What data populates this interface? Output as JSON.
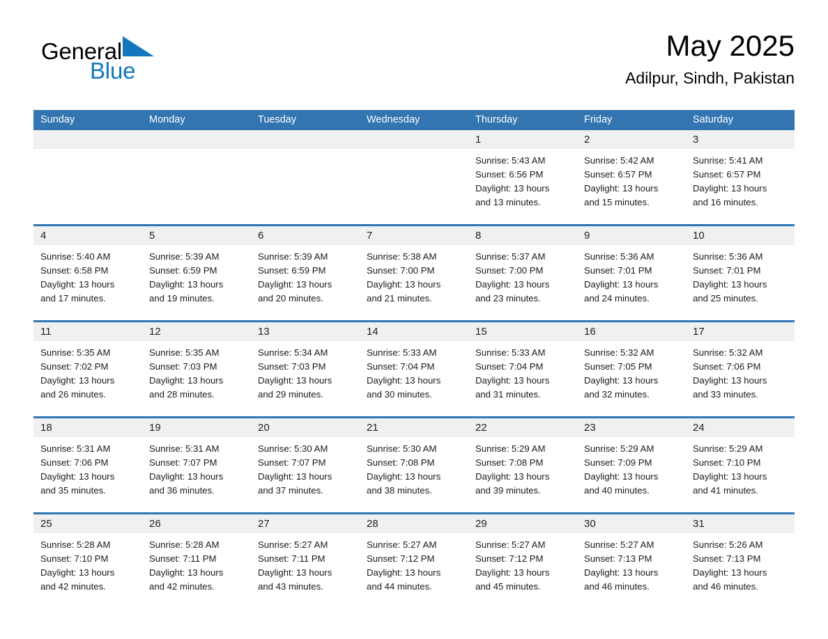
{
  "brand": {
    "name_part1": "General",
    "name_part2": "Blue",
    "triangle_icon": "blue-triangle-icon",
    "accent_color": "#1277bc"
  },
  "header": {
    "month_title": "May 2025",
    "location": "Adilpur, Sindh, Pakistan"
  },
  "colors": {
    "header_blue": "#3275b1",
    "row_divider_blue": "#2e75b3",
    "daynum_band_gray": "#f0f0f0",
    "text_dark": "#1a1a1a"
  },
  "calendar": {
    "weekdays": [
      "Sunday",
      "Monday",
      "Tuesday",
      "Wednesday",
      "Thursday",
      "Friday",
      "Saturday"
    ],
    "weeks": [
      [
        {
          "day": "",
          "lines": []
        },
        {
          "day": "",
          "lines": []
        },
        {
          "day": "",
          "lines": []
        },
        {
          "day": "",
          "lines": []
        },
        {
          "day": "1",
          "lines": [
            "Sunrise: 5:43 AM",
            "Sunset: 6:56 PM",
            "Daylight: 13 hours",
            "and 13 minutes."
          ]
        },
        {
          "day": "2",
          "lines": [
            "Sunrise: 5:42 AM",
            "Sunset: 6:57 PM",
            "Daylight: 13 hours",
            "and 15 minutes."
          ]
        },
        {
          "day": "3",
          "lines": [
            "Sunrise: 5:41 AM",
            "Sunset: 6:57 PM",
            "Daylight: 13 hours",
            "and 16 minutes."
          ]
        }
      ],
      [
        {
          "day": "4",
          "lines": [
            "Sunrise: 5:40 AM",
            "Sunset: 6:58 PM",
            "Daylight: 13 hours",
            "and 17 minutes."
          ]
        },
        {
          "day": "5",
          "lines": [
            "Sunrise: 5:39 AM",
            "Sunset: 6:59 PM",
            "Daylight: 13 hours",
            "and 19 minutes."
          ]
        },
        {
          "day": "6",
          "lines": [
            "Sunrise: 5:39 AM",
            "Sunset: 6:59 PM",
            "Daylight: 13 hours",
            "and 20 minutes."
          ]
        },
        {
          "day": "7",
          "lines": [
            "Sunrise: 5:38 AM",
            "Sunset: 7:00 PM",
            "Daylight: 13 hours",
            "and 21 minutes."
          ]
        },
        {
          "day": "8",
          "lines": [
            "Sunrise: 5:37 AM",
            "Sunset: 7:00 PM",
            "Daylight: 13 hours",
            "and 23 minutes."
          ]
        },
        {
          "day": "9",
          "lines": [
            "Sunrise: 5:36 AM",
            "Sunset: 7:01 PM",
            "Daylight: 13 hours",
            "and 24 minutes."
          ]
        },
        {
          "day": "10",
          "lines": [
            "Sunrise: 5:36 AM",
            "Sunset: 7:01 PM",
            "Daylight: 13 hours",
            "and 25 minutes."
          ]
        }
      ],
      [
        {
          "day": "11",
          "lines": [
            "Sunrise: 5:35 AM",
            "Sunset: 7:02 PM",
            "Daylight: 13 hours",
            "and 26 minutes."
          ]
        },
        {
          "day": "12",
          "lines": [
            "Sunrise: 5:35 AM",
            "Sunset: 7:03 PM",
            "Daylight: 13 hours",
            "and 28 minutes."
          ]
        },
        {
          "day": "13",
          "lines": [
            "Sunrise: 5:34 AM",
            "Sunset: 7:03 PM",
            "Daylight: 13 hours",
            "and 29 minutes."
          ]
        },
        {
          "day": "14",
          "lines": [
            "Sunrise: 5:33 AM",
            "Sunset: 7:04 PM",
            "Daylight: 13 hours",
            "and 30 minutes."
          ]
        },
        {
          "day": "15",
          "lines": [
            "Sunrise: 5:33 AM",
            "Sunset: 7:04 PM",
            "Daylight: 13 hours",
            "and 31 minutes."
          ]
        },
        {
          "day": "16",
          "lines": [
            "Sunrise: 5:32 AM",
            "Sunset: 7:05 PM",
            "Daylight: 13 hours",
            "and 32 minutes."
          ]
        },
        {
          "day": "17",
          "lines": [
            "Sunrise: 5:32 AM",
            "Sunset: 7:06 PM",
            "Daylight: 13 hours",
            "and 33 minutes."
          ]
        }
      ],
      [
        {
          "day": "18",
          "lines": [
            "Sunrise: 5:31 AM",
            "Sunset: 7:06 PM",
            "Daylight: 13 hours",
            "and 35 minutes."
          ]
        },
        {
          "day": "19",
          "lines": [
            "Sunrise: 5:31 AM",
            "Sunset: 7:07 PM",
            "Daylight: 13 hours",
            "and 36 minutes."
          ]
        },
        {
          "day": "20",
          "lines": [
            "Sunrise: 5:30 AM",
            "Sunset: 7:07 PM",
            "Daylight: 13 hours",
            "and 37 minutes."
          ]
        },
        {
          "day": "21",
          "lines": [
            "Sunrise: 5:30 AM",
            "Sunset: 7:08 PM",
            "Daylight: 13 hours",
            "and 38 minutes."
          ]
        },
        {
          "day": "22",
          "lines": [
            "Sunrise: 5:29 AM",
            "Sunset: 7:08 PM",
            "Daylight: 13 hours",
            "and 39 minutes."
          ]
        },
        {
          "day": "23",
          "lines": [
            "Sunrise: 5:29 AM",
            "Sunset: 7:09 PM",
            "Daylight: 13 hours",
            "and 40 minutes."
          ]
        },
        {
          "day": "24",
          "lines": [
            "Sunrise: 5:29 AM",
            "Sunset: 7:10 PM",
            "Daylight: 13 hours",
            "and 41 minutes."
          ]
        }
      ],
      [
        {
          "day": "25",
          "lines": [
            "Sunrise: 5:28 AM",
            "Sunset: 7:10 PM",
            "Daylight: 13 hours",
            "and 42 minutes."
          ]
        },
        {
          "day": "26",
          "lines": [
            "Sunrise: 5:28 AM",
            "Sunset: 7:11 PM",
            "Daylight: 13 hours",
            "and 42 minutes."
          ]
        },
        {
          "day": "27",
          "lines": [
            "Sunrise: 5:27 AM",
            "Sunset: 7:11 PM",
            "Daylight: 13 hours",
            "and 43 minutes."
          ]
        },
        {
          "day": "28",
          "lines": [
            "Sunrise: 5:27 AM",
            "Sunset: 7:12 PM",
            "Daylight: 13 hours",
            "and 44 minutes."
          ]
        },
        {
          "day": "29",
          "lines": [
            "Sunrise: 5:27 AM",
            "Sunset: 7:12 PM",
            "Daylight: 13 hours",
            "and 45 minutes."
          ]
        },
        {
          "day": "30",
          "lines": [
            "Sunrise: 5:27 AM",
            "Sunset: 7:13 PM",
            "Daylight: 13 hours",
            "and 46 minutes."
          ]
        },
        {
          "day": "31",
          "lines": [
            "Sunrise: 5:26 AM",
            "Sunset: 7:13 PM",
            "Daylight: 13 hours",
            "and 46 minutes."
          ]
        }
      ]
    ]
  }
}
